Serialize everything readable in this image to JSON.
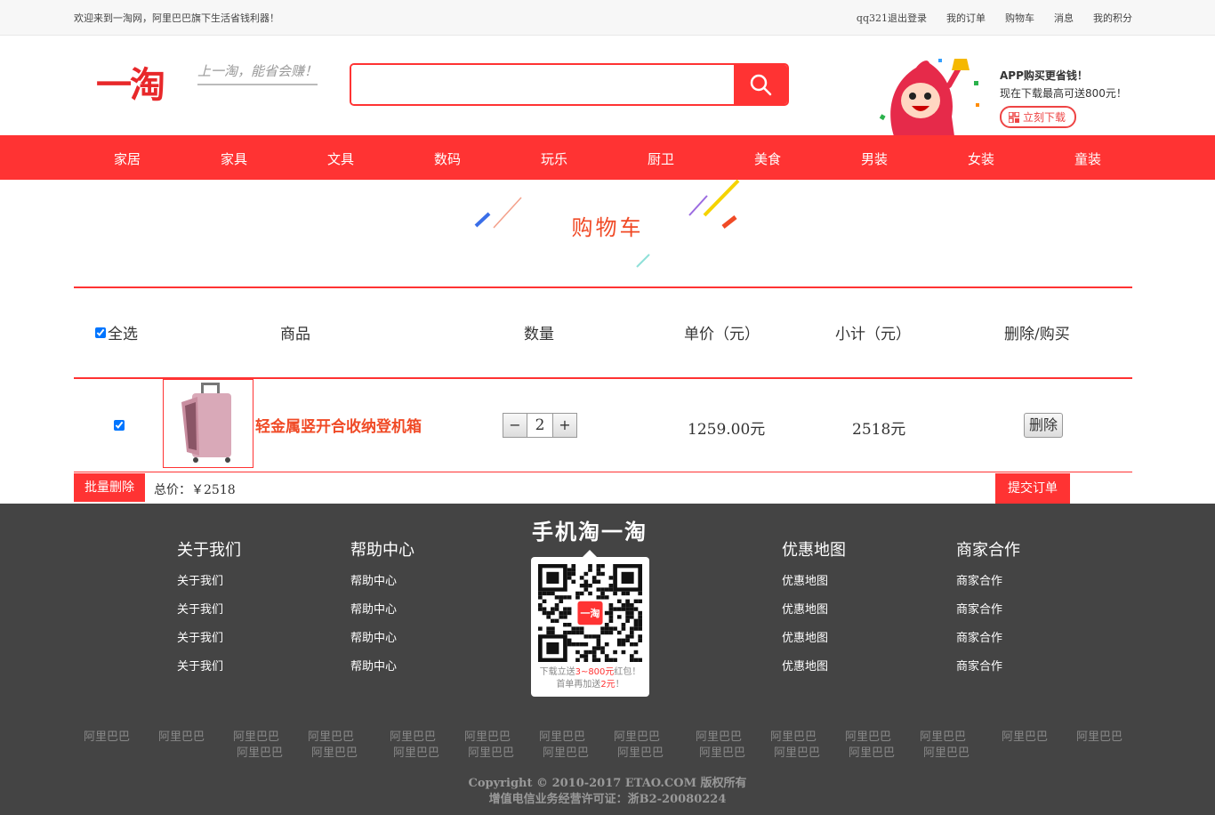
{
  "topbar": {
    "welcome": "欢迎来到一淘网，阿里巴巴旗下生活省钱利器！",
    "links": [
      "qq321退出登录",
      "我的订单",
      "购物车",
      "消息",
      "我的积分"
    ]
  },
  "header": {
    "logo": "一淘",
    "slogan": "上一淘，能省会赚！",
    "search_placeholder": "",
    "app_ad": {
      "line1": "APP购买更省钱！",
      "line2": "现在下载最高可送800元！",
      "download": "立刻下载"
    }
  },
  "nav": [
    "家居",
    "家具",
    "文具",
    "数码",
    "玩乐",
    "厨卫",
    "美食",
    "男装",
    "女装",
    "童装"
  ],
  "cart": {
    "title": "购物车",
    "headers": {
      "select_all": "全选",
      "product": "商品",
      "quantity": "数量",
      "unit_price": "单价（元）",
      "subtotal": "小计（元）",
      "action": "删除/购买"
    },
    "items": [
      {
        "name": "轻金属竖开合收纳登机箱",
        "quantity": "2",
        "unit_price": "1259.00元",
        "subtotal": "2518元",
        "delete": "删除",
        "checked": true
      }
    ],
    "batch_delete": "批量删除",
    "total_label": "总价：￥2518",
    "submit": "提交订单"
  },
  "footer": {
    "qr_title": "手机淘一淘",
    "qr_text1a": "下载立送",
    "qr_text1b": "3~800元",
    "qr_text1c": "红包！",
    "qr_text2a": "首单再加送",
    "qr_text2b": "2元",
    "qr_text2c": "！",
    "qr_center": "一淘",
    "columns": [
      {
        "title": "关于我们",
        "links": [
          "关于我们",
          "关于我们",
          "关于我们",
          "关于我们"
        ]
      },
      {
        "title": "帮助中心",
        "links": [
          "帮助中心",
          "帮助中心",
          "帮助中心",
          "帮助中心"
        ]
      },
      {
        "title": "优惠地图",
        "links": [
          "优惠地图",
          "优惠地图",
          "优惠地图",
          "优惠地图"
        ]
      },
      {
        "title": "商家合作",
        "links": [
          "商家合作",
          "商家合作",
          "商家合作",
          "商家合作"
        ]
      }
    ],
    "partner": "阿里巴巴",
    "copyright": "Copyright © 2010-2017 ETAO.COM 版权所有",
    "license": "增值电信业务经营许可证：浙B2-20080224"
  },
  "colors": {
    "accent": "#ff3333",
    "title": "#f04a26",
    "footer_bg": "#444444"
  }
}
